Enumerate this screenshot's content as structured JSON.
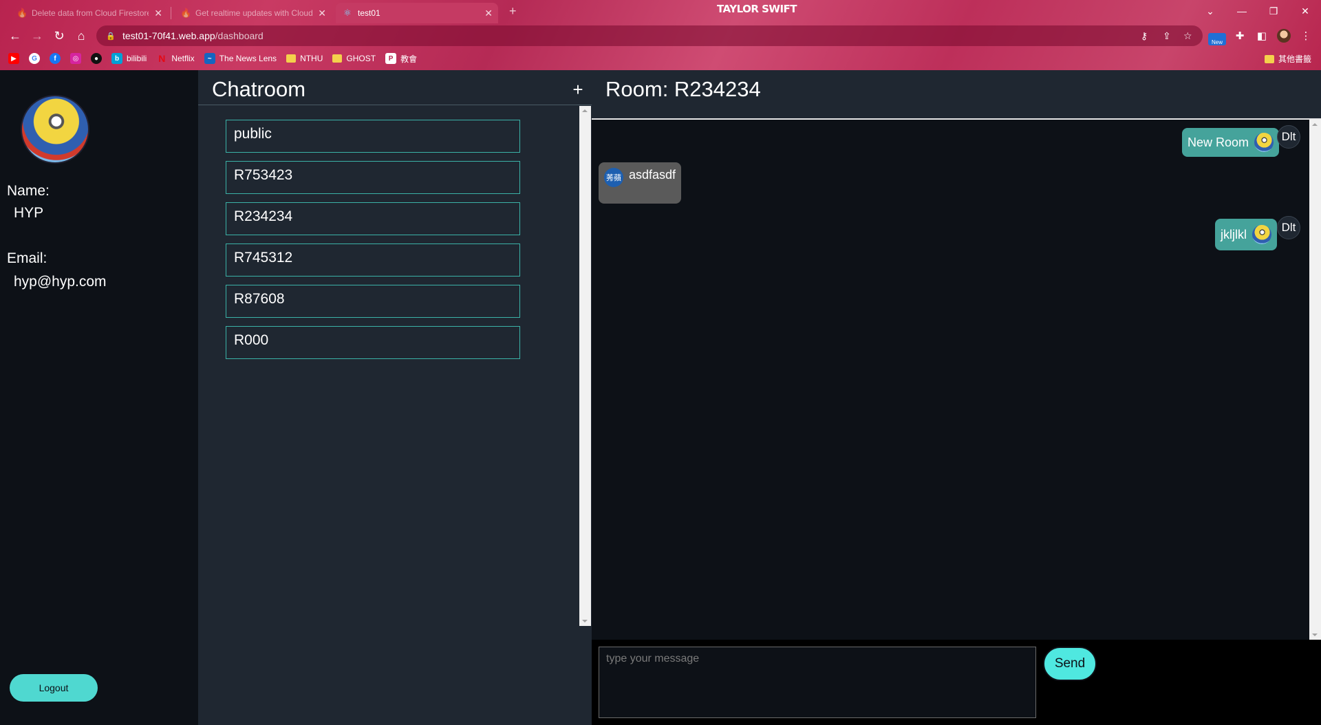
{
  "browser": {
    "tabs": [
      {
        "title": "Delete data from Cloud Firestore"
      },
      {
        "title": "Get realtime updates with Cloud Firestore"
      },
      {
        "title": "test01"
      }
    ],
    "theme_title": "TAYLOR SWIFT",
    "url_host": "test01-70f41.web.app",
    "url_path": "/dashboard",
    "new_badge": "New",
    "bookmarks": [
      {
        "label": "bilibili"
      },
      {
        "label": "Netflix"
      },
      {
        "label": "The News Lens"
      },
      {
        "label": "NTHU"
      },
      {
        "label": "GHOST"
      },
      {
        "label": "教會"
      }
    ],
    "other_bookmarks": "其他書籤"
  },
  "profile": {
    "name_label": "Name:",
    "name": "HYP",
    "email_label": "Email:",
    "email": "hyp@hyp.com",
    "logout": "Logout"
  },
  "rooms": {
    "title": "Chatroom",
    "add": "+",
    "items": [
      "public",
      "R753423",
      "R234234",
      "R745312",
      "R87608",
      "R000"
    ]
  },
  "chat": {
    "room_title": "Room: R234234",
    "messages": [
      {
        "text": "New Room",
        "own": true,
        "delete": "Dlt"
      },
      {
        "text": "asdfasdf",
        "own": false,
        "avatar_text": "莠蘋"
      },
      {
        "text": "jkljlkl",
        "own": true,
        "delete": "Dlt"
      }
    ],
    "input_placeholder": "type your message",
    "send": "Send"
  },
  "colors": {
    "accent": "#4fd8d0",
    "own_bubble": "#45a39b",
    "other_bubble": "#5a5a5a",
    "room_border": "#3bb3a8"
  }
}
